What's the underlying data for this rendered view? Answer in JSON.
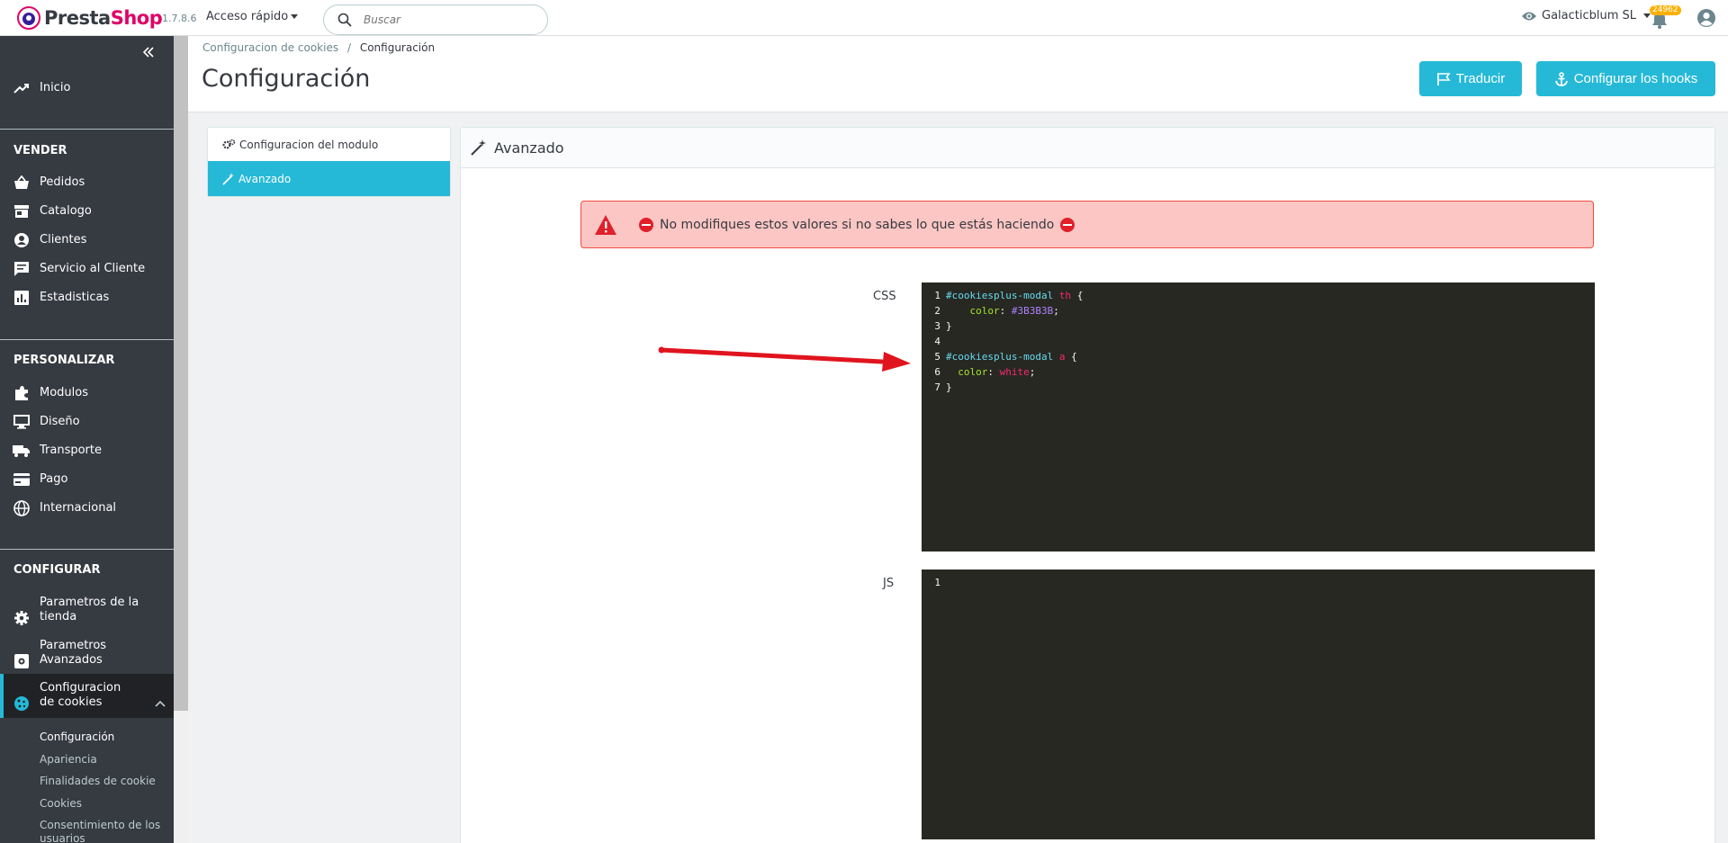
{
  "header": {
    "logo_presta": "Presta",
    "logo_shop": "Shop",
    "version": "1.7.8.6",
    "quick_access": "Acceso rápido",
    "search_placeholder": "Buscar",
    "shop_name": "Galacticblum SL",
    "notification_count": "24962"
  },
  "sidebar": {
    "inicio": "Inicio",
    "section_vender": "VENDER",
    "vender": [
      "Pedidos",
      "Catalogo",
      "Clientes",
      "Servicio al Cliente",
      "Estadisticas"
    ],
    "section_personalizar": "PERSONALIZAR",
    "personalizar": [
      "Modulos",
      "Diseño",
      "Transporte",
      "Pago",
      "Internacional"
    ],
    "section_configurar": "CONFIGURAR",
    "configurar": [
      "Parametros de la tienda",
      "Parametros Avanzados",
      "Configuracion de cookies"
    ],
    "sub_items": [
      "Configuración",
      "Apariencia",
      "Finalidades de cookie",
      "Cookies",
      "Consentimiento de los usuarios"
    ]
  },
  "breadcrumb": {
    "parent": "Configuracion de cookies",
    "separator": "/",
    "current": "Configuración"
  },
  "page_title": "Configuración",
  "buttons": {
    "translate": "Traducir",
    "hooks": "Configurar los hooks"
  },
  "tabs": [
    "Configuracion del modulo",
    "Avanzado"
  ],
  "panel": {
    "title": "Avanzado",
    "alert": "No modifiques estos valores si no sabes lo que estás haciendo",
    "css_label": "CSS",
    "js_label": "JS"
  },
  "css_editor": {
    "line_numbers": [
      "1",
      "2",
      "3",
      "4",
      "5",
      "6",
      "7"
    ],
    "line1_sel": "#cookiesplus-modal",
    "line1_tag": "th",
    "line1_brace": "{",
    "line2_prop": "color",
    "line2_colon": ":",
    "line2_val": "#3B3B3B",
    "line2_semi": ";",
    "line3": "}",
    "line5_sel": "#cookiesplus-modal",
    "line5_tag": "a",
    "line5_brace": "{",
    "line6_prop": "color",
    "line6_colon": ":",
    "line6_val": "white",
    "line6_semi": ";",
    "line7": "}"
  },
  "js_editor": {
    "line_numbers": [
      "1"
    ]
  },
  "colors": {
    "accent": "#25b9d7",
    "sidebar": "#363a41",
    "brand": "#df0067",
    "alert_bg": "#fbc6c3",
    "editor_bg": "#272822",
    "annotation_arrow": "#e0141e"
  }
}
